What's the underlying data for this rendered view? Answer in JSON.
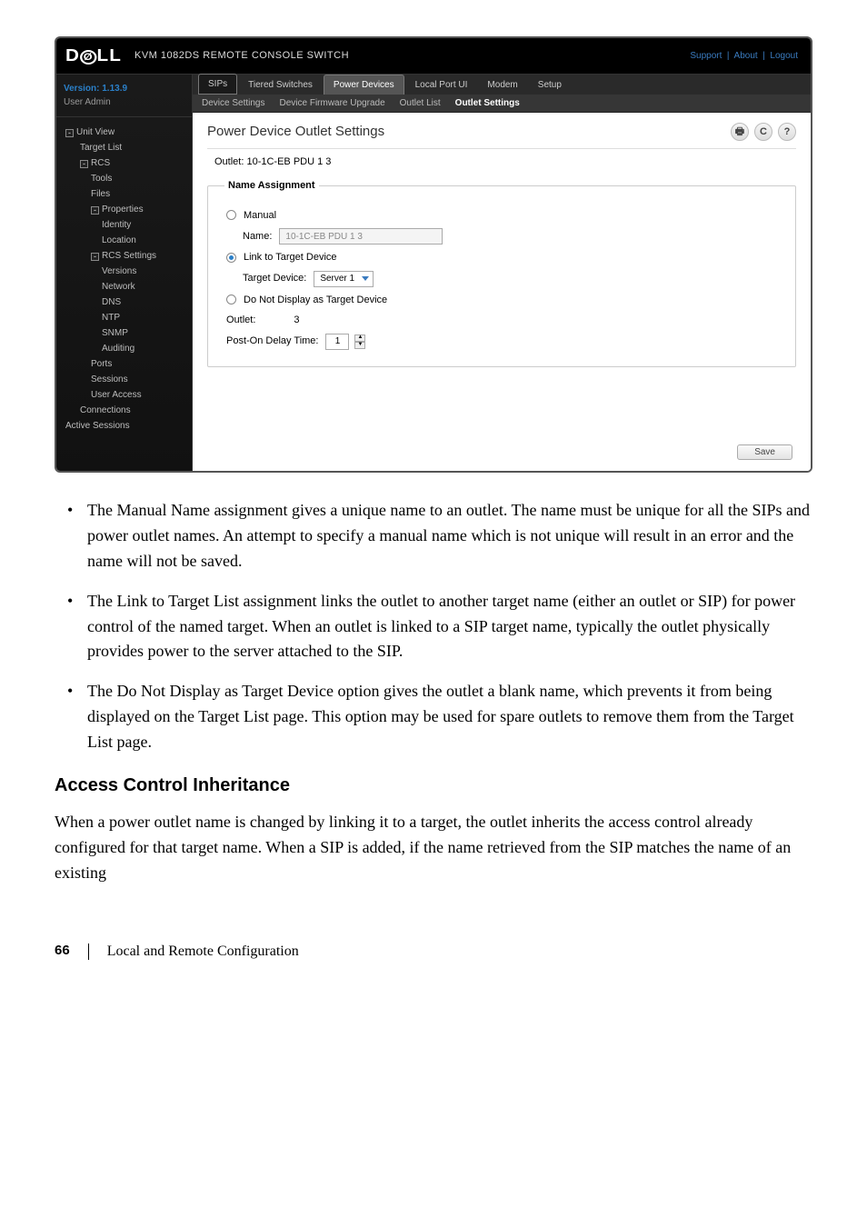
{
  "screenshot": {
    "brand": "DELL",
    "title": "KVM 1082DS REMOTE CONSOLE SWITCH",
    "top_links": {
      "support": "Support",
      "about": "About",
      "logout": "Logout"
    },
    "version_label": "Version: 1.13.9",
    "user_line": "User Admin",
    "tree": {
      "unit_view": "Unit View",
      "target_list": "Target List",
      "rcs": "RCS",
      "tools": "Tools",
      "files": "Files",
      "properties": "Properties",
      "identity": "Identity",
      "location": "Location",
      "rcs_settings": "RCS Settings",
      "versions": "Versions",
      "network": "Network",
      "dns": "DNS",
      "ntp": "NTP",
      "snmp": "SNMP",
      "auditing": "Auditing",
      "ports": "Ports",
      "sessions": "Sessions",
      "user_access": "User Access",
      "connections": "Connections",
      "active_sessions": "Active Sessions"
    },
    "tabs_primary": {
      "sips": "SIPs",
      "tiered_switches": "Tiered Switches",
      "power_devices": "Power Devices",
      "local_port_ui": "Local Port UI",
      "modem": "Modem",
      "setup": "Setup"
    },
    "tabs_secondary": {
      "device_settings": "Device Settings",
      "device_firmware_upgrade": "Device Firmware Upgrade",
      "outlet_list": "Outlet List",
      "outlet_settings": "Outlet Settings"
    },
    "content": {
      "heading": "Power Device Outlet Settings",
      "outlet_label": "Outlet: 10-1C-EB PDU 1 3",
      "fieldset_legend": "Name Assignment",
      "radio_manual": "Manual",
      "name_label": "Name:",
      "name_value": "10-1C-EB PDU 1 3",
      "radio_link": "Link to Target Device",
      "target_device_label": "Target Device:",
      "target_device_value": "Server 1",
      "radio_donot": "Do Not Display as Target Device",
      "outlet_num_label": "Outlet:",
      "outlet_num_value": "3",
      "post_on_label": "Post-On Delay Time:",
      "post_on_value": "1",
      "save_btn": "Save"
    },
    "topicons": {
      "print": "🖶",
      "refresh": "C",
      "help": "?"
    }
  },
  "doc": {
    "bullets": [
      "The Manual Name assignment gives a unique name to an outlet. The name must be unique for all the SIPs and power outlet names. An attempt to specify a manual name which is not unique will result in an error and the name will not be saved.",
      "The Link to Target List assignment links the outlet to another target name (either an outlet or SIP) for power control of the named target. When an outlet is linked to a SIP target name, typically the outlet physically provides power to the server attached to the SIP.",
      "The Do Not Display as Target Device option gives the outlet a blank name, which prevents it from being displayed on the Target List page. This option may be used for spare outlets to remove them from the Target List page."
    ],
    "h3": "Access Control Inheritance",
    "paragraph": "When a power outlet name is changed by linking it to a target, the outlet inherits the access control already configured for that target name. When a SIP is added, if the name retrieved from the SIP matches the name of an existing",
    "footer_page": "66",
    "footer_title": "Local and Remote Configuration"
  }
}
